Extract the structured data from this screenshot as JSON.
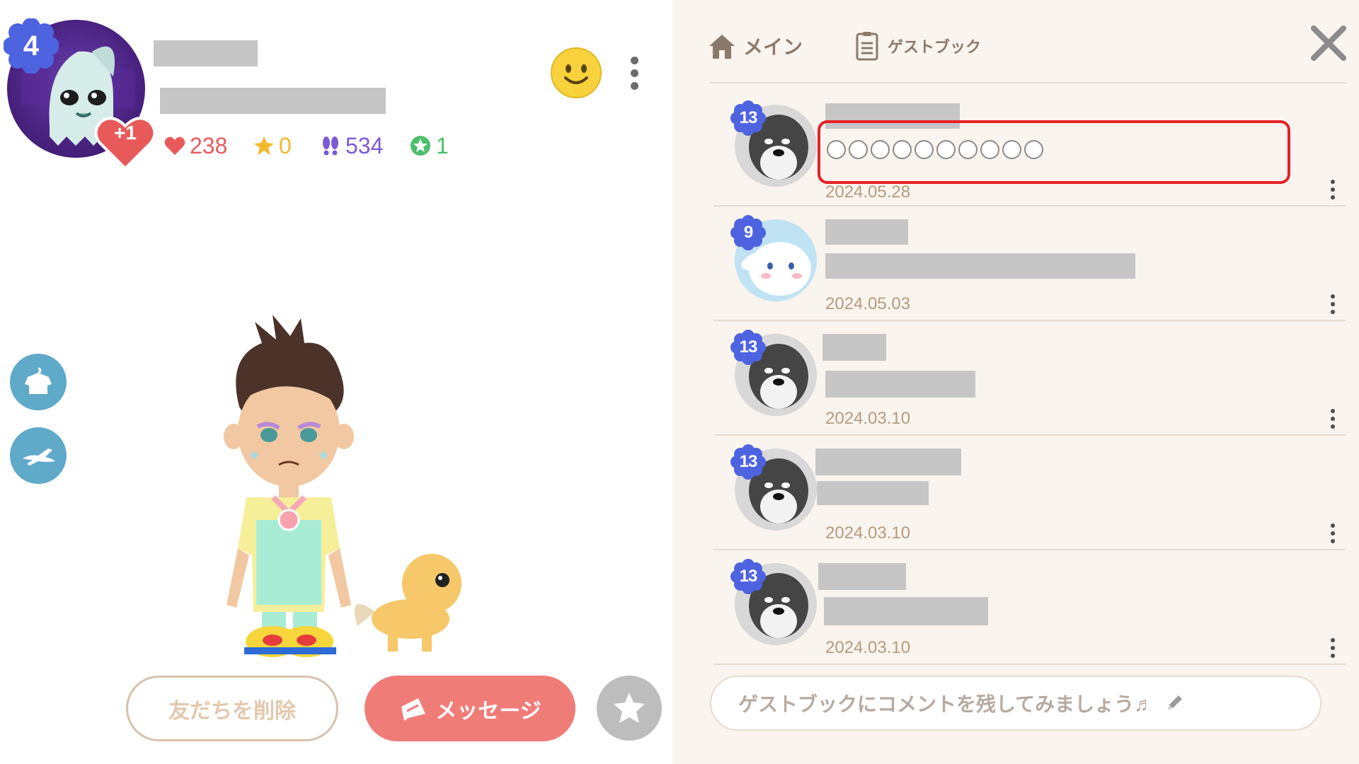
{
  "profile": {
    "level": "4",
    "plus_badge": "+1",
    "stats": {
      "hearts": "238",
      "stars": "0",
      "footprints": "534",
      "green": "1"
    }
  },
  "actions": {
    "remove_friend": "友だちを削除",
    "message": "メッセージ"
  },
  "guestbook": {
    "tab_main": "メイン",
    "tab_guestbook": "ゲストブック",
    "comment_placeholder": "ゲストブックにコメントを残してみましょう♬",
    "entries": [
      {
        "level": "13",
        "date": "2024.05.28"
      },
      {
        "level": "9",
        "date": "2024.05.03"
      },
      {
        "level": "13",
        "date": "2024.03.10"
      },
      {
        "level": "13",
        "date": "2024.03.10"
      },
      {
        "level": "13",
        "date": "2024.03.10"
      }
    ]
  },
  "colors": {
    "heart": "#e85a5a",
    "star": "#f2b92c",
    "footprints": "#7b59d6",
    "green": "#4cbf6a",
    "message_button": "#f07c78",
    "highlight": "#e52028",
    "level_badge": "#4d63e0"
  },
  "icons": {
    "tab_main": "home-icon",
    "tab_guestbook": "notebook-icon",
    "close": "close-icon",
    "side_1": "outfit-icon",
    "side_2": "plane-icon",
    "favorite": "star-icon",
    "mood": "smiley-icon"
  }
}
